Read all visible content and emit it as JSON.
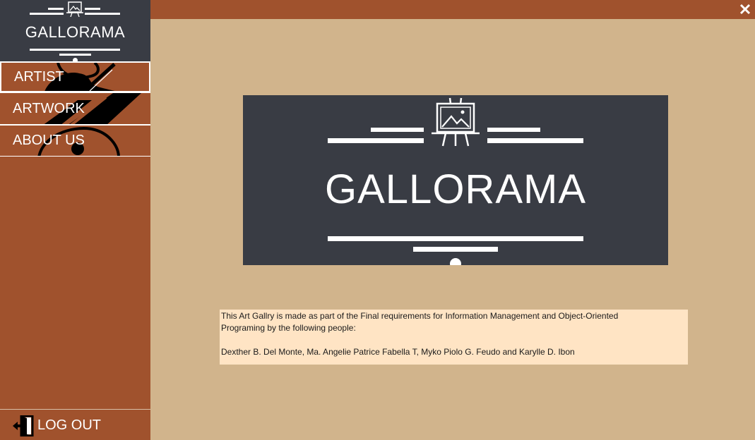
{
  "app": {
    "logo_text": "GALLORAMA",
    "brand_colors": {
      "sidebar": "#a0522d",
      "dark": "#393c44",
      "background": "#d1b48c",
      "info_panel": "#ffe4c4"
    }
  },
  "sidebar": {
    "items": [
      {
        "label": "ARTIST",
        "icon": "palette-brush-icon",
        "active": true
      },
      {
        "label": "ARTWORK",
        "icon": "brush-stroke-icon",
        "active": false
      },
      {
        "label": "ABOUT US",
        "icon": "circle-art-icon",
        "active": false
      }
    ],
    "logout_label": "LOG OUT",
    "logout_icon": "logout-door-icon"
  },
  "topbar": {
    "close_icon": "close-icon"
  },
  "banner": {
    "title": "GALLORAMA",
    "icon": "easel-icon"
  },
  "info": {
    "line1": "This Art Gallry is made as part of the Final requirements for Information Management and Object-Oriented",
    "line2": "Programing by the following people:",
    "line3": "Dexther B. Del Monte, Ma. Angelie Patrice Fabella T, Myko Piolo G. Feudo and Karylle D. Ibon"
  }
}
